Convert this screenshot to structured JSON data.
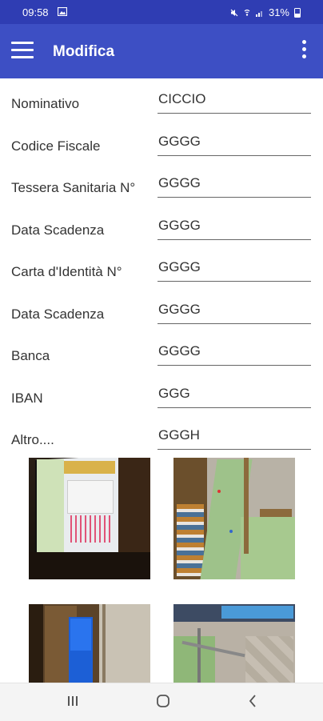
{
  "status_bar": {
    "time": "09:58",
    "battery": "31%"
  },
  "app_bar": {
    "title": "Modifica"
  },
  "form": {
    "rows": [
      {
        "label": "Nominativo",
        "value": "CICCIO"
      },
      {
        "label": "Codice Fiscale",
        "value": "GGGG"
      },
      {
        "label": "Tessera Sanitaria N°",
        "value": "GGGG"
      },
      {
        "label": "Data Scadenza",
        "value": "GGGG"
      },
      {
        "label": "Carta d'Identità N°",
        "value": "GGGG"
      },
      {
        "label": "Data Scadenza",
        "value": "GGGG"
      },
      {
        "label": "Banca",
        "value": "GGGG"
      },
      {
        "label": "IBAN",
        "value": "GGG"
      },
      {
        "label": "Altro....",
        "value": "GGGH"
      }
    ]
  },
  "colors": {
    "status_bar": "#2f3db3",
    "app_bar": "#3d4fc4"
  }
}
